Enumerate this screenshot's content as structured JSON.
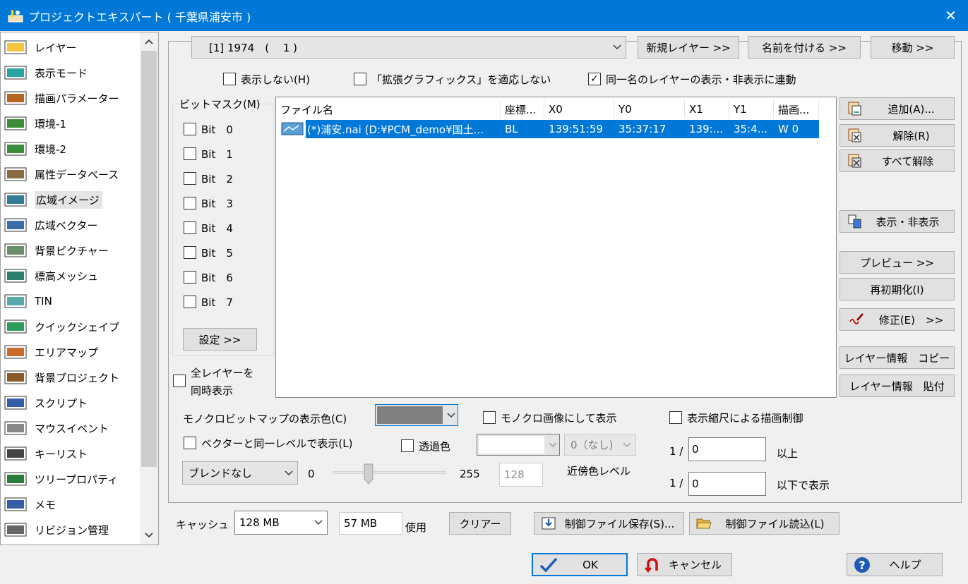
{
  "window": {
    "title": "プロジェクトエキスパート ( 千葉県浦安市 )",
    "close_glyph": "✕"
  },
  "sidebar": {
    "items": [
      {
        "label": "レイヤー",
        "icon": "layer-icon"
      },
      {
        "label": "表示モード",
        "icon": "display-mode-icon"
      },
      {
        "label": "描画パラメーター",
        "icon": "draw-param-icon"
      },
      {
        "label": "環境-1",
        "icon": "environment-icon"
      },
      {
        "label": "環境-2",
        "icon": "environment-icon"
      },
      {
        "label": "属性データベース",
        "icon": "database-icon"
      },
      {
        "label": "広域イメージ",
        "icon": "wide-image-icon"
      },
      {
        "label": "広域ベクター",
        "icon": "wide-vector-icon"
      },
      {
        "label": "背景ピクチャー",
        "icon": "background-picture-icon"
      },
      {
        "label": "標高メッシュ",
        "icon": "elevation-mesh-icon"
      },
      {
        "label": "TIN",
        "icon": "tin-icon"
      },
      {
        "label": "クイックシェイプ",
        "icon": "quick-shape-icon"
      },
      {
        "label": "エリアマップ",
        "icon": "area-map-icon"
      },
      {
        "label": "背景プロジェクト",
        "icon": "background-project-icon"
      },
      {
        "label": "スクリプト",
        "icon": "script-icon"
      },
      {
        "label": "マウスイベント",
        "icon": "mouse-icon"
      },
      {
        "label": "キーリスト",
        "icon": "key-list-icon"
      },
      {
        "label": "ツリープロパティ",
        "icon": "tree-property-icon"
      },
      {
        "label": "メモ",
        "icon": "memo-icon"
      },
      {
        "label": "リビジョン管理",
        "icon": "revision-icon"
      }
    ],
    "selected": "広域イメージ"
  },
  "layer_select": {
    "value": "[1] 1974　( 　1 )"
  },
  "top_buttons": {
    "new_layer": "新規レイヤー >>",
    "rename": "名前を付ける >>",
    "move": "移動 >>"
  },
  "checks": {
    "hide": "表示しない(H)",
    "no_ext_graphics": "「拡張グラフィックス」を適応しない",
    "sync_same_name": "同一名のレイヤーの表示・非表示に連動",
    "sync_checked": "✓"
  },
  "bitmask": {
    "title": "ビットマスク(M)",
    "bits": [
      "Bit　0",
      "Bit　1",
      "Bit　2",
      "Bit　3",
      "Bit　4",
      "Bit　5",
      "Bit　6",
      "Bit　7"
    ],
    "set_button": "設定 >>"
  },
  "all_layers": {
    "line1": "全レイヤーを",
    "line2": "同時表示"
  },
  "table": {
    "columns": [
      "ファイル名",
      "座標...",
      "X0",
      "Y0",
      "X1",
      "Y1",
      "描画..."
    ],
    "rows": [
      [
        "(*)浦安.nai (D:¥PCM_demo¥国土...",
        "BL",
        "139:51:59",
        "35:37:17",
        "139:...",
        "35:4...",
        "W 0"
      ]
    ]
  },
  "right_buttons": {
    "add": "追加(A)...",
    "remove": "解除(R)",
    "remove_all": "すべて解除",
    "toggle": "表示・非表示",
    "preview": "プレビュー >>",
    "reinit": "再初期化(I)",
    "modify": "修正(E)　>>",
    "copy_info": "レイヤー情報　コピー",
    "paste_info": "レイヤー情報　貼付"
  },
  "mono": {
    "label": "モノクロビットマップの表示色(C)",
    "color": "#808080",
    "mono_image": "モノクロ画像にして表示",
    "scale_ctrl": "表示縮尺による描画制御"
  },
  "vector_level": "ベクターと同一レベルで表示(L)",
  "transparent": {
    "label": "透過色",
    "near_value": "0（なし)",
    "near_label": "近傍色レベル"
  },
  "blend": {
    "value": "ブレンドなし",
    "min": "0",
    "max": "255",
    "current": "128",
    "slider_fraction": 0.31
  },
  "scale": {
    "prefix1": "1 /",
    "value1": "0",
    "suffix1": "以上",
    "prefix2": "1 /",
    "value2": "0",
    "suffix2": "以下で表示"
  },
  "cache": {
    "label": "キャッシュ",
    "size": "128 MB",
    "used": "57 MB",
    "used_label": "使用",
    "clear": "クリアー"
  },
  "ctrl_buttons": {
    "save": "制御ファイル保存(S)...",
    "load": "制御ファイル読込(L)"
  },
  "footer": {
    "ok": "OK",
    "cancel": "キャンセル",
    "help": "ヘルプ"
  },
  "colors": {
    "titlebar": "#0078d7",
    "selection": "#0078d7"
  }
}
